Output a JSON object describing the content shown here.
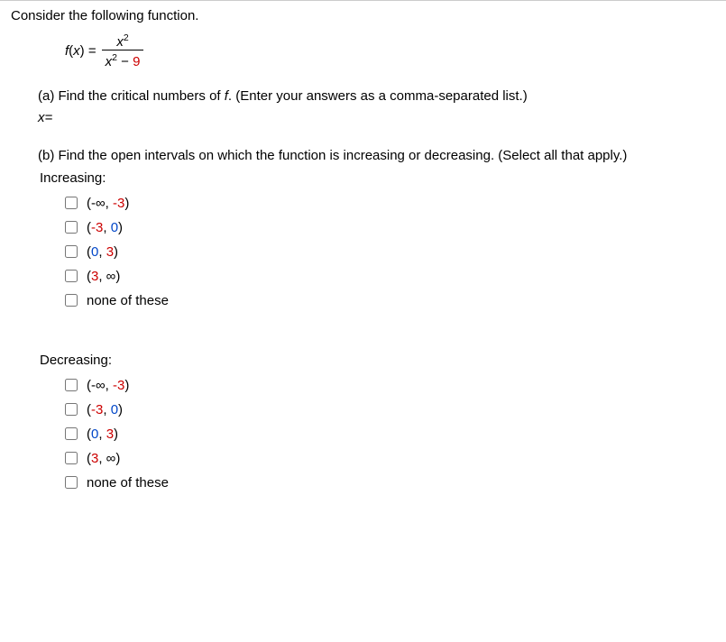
{
  "intro": "Consider the following function.",
  "formula": {
    "lhs_f": "f",
    "lhs_paren_open": "(",
    "lhs_x": "x",
    "lhs_paren_close": ") = ",
    "num_x": "x",
    "num_exp": "2",
    "den_x": "x",
    "den_exp": "2",
    "den_minus": " − ",
    "den_const": "9"
  },
  "partA": {
    "text_prefix": "(a) Find the critical numbers of ",
    "text_f": "f",
    "text_suffix": ". (Enter your answers as a comma-separated list.)",
    "answer_prompt": "x="
  },
  "partB": {
    "text": "(b) Find the open intervals on which the function is increasing or decreasing. (Select all that apply.)",
    "increasing_label": "Increasing:",
    "decreasing_label": "Decreasing:"
  },
  "options": [
    {
      "open": "(-∞, ",
      "red": "-3",
      "close": ")"
    },
    {
      "open": "(",
      "red": "-3",
      "mid": ", ",
      "blue": "0",
      "close": ")"
    },
    {
      "open": "(",
      "blue": "0",
      "mid": ", ",
      "red2": "3",
      "close": ")"
    },
    {
      "open": "(",
      "red": "3",
      "mid": ", ∞)",
      "close": ""
    },
    {
      "plain": "none of these"
    }
  ]
}
